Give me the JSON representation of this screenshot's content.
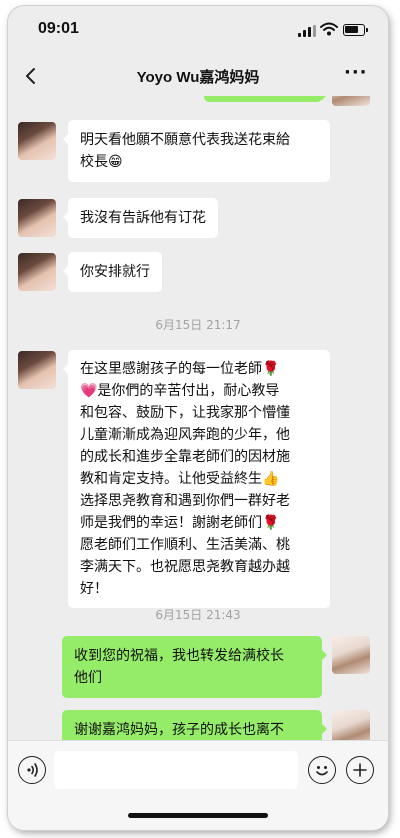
{
  "status_bar": {
    "time": "09:01"
  },
  "header": {
    "title": "Yoyo Wu嘉鸿妈妈",
    "more_label": "···"
  },
  "messages": [
    {
      "from": "contact",
      "text": "明天看他願不願意代表我送花束給校長😁"
    },
    {
      "from": "contact",
      "text": "我沒有告訴他有订花"
    },
    {
      "from": "contact",
      "text": "你安排就行"
    },
    {
      "timestamp": "6月15日 21:17"
    },
    {
      "from": "contact",
      "text": "在这里感謝孩子的每一位老師🌹💗是你們的辛苦付出，耐心教导和包容、鼓励下，让我家那个懵懂儿童漸漸成為迎风奔跑的少年，他的成长和進步全靠老師们的因材施教和肯定支持。让他受益終生👍选择思尧教育和遇到你們一群好老师是我們的幸运！謝謝老師们🌹愿老師们工作順利、生活美滿、桃李满天下。也祝愿思尧教育越办越好！"
    },
    {
      "timestamp": "6月15日 21:43"
    },
    {
      "from": "me",
      "text": "收到您的祝福，我也转发给满校长他们"
    },
    {
      "from": "me",
      "text": "谢谢嘉鸿妈妈，孩子的成长也离不"
    }
  ],
  "message_lines": {
    "m1": [
      "明天看他願不願意代表我送花束給",
      "校長😁"
    ],
    "m5": [
      "在这里感謝孩子的每一位老師🌹",
      "💗是你們的辛苦付出，耐心教导",
      "和包容、鼓励下，让我家那个懵懂",
      "儿童漸漸成為迎风奔跑的少年，他",
      "的成长和進步全靠老師们的因材施",
      "教和肯定支持。让他受益終生👍",
      "选择思尧教育和遇到你們一群好老",
      "师是我們的幸运！謝謝老師们🌹",
      "愿老師们工作順利、生活美滿、桃",
      "李满天下。也祝愿思尧教育越办越",
      "好！"
    ],
    "m7": [
      "收到您的祝福，我也转发给满校长",
      "他们"
    ]
  },
  "colors": {
    "chat_background": "#ededed",
    "incoming_bubble": "#ffffff",
    "outgoing_bubble": "#95ec69",
    "timestamp_text": "#a3a3a3"
  },
  "icons": {
    "back": "chevron-left-icon",
    "more": "more-dots-icon",
    "voice": "voice-icon",
    "emoji": "emoji-icon",
    "add": "plus-circle-icon"
  }
}
